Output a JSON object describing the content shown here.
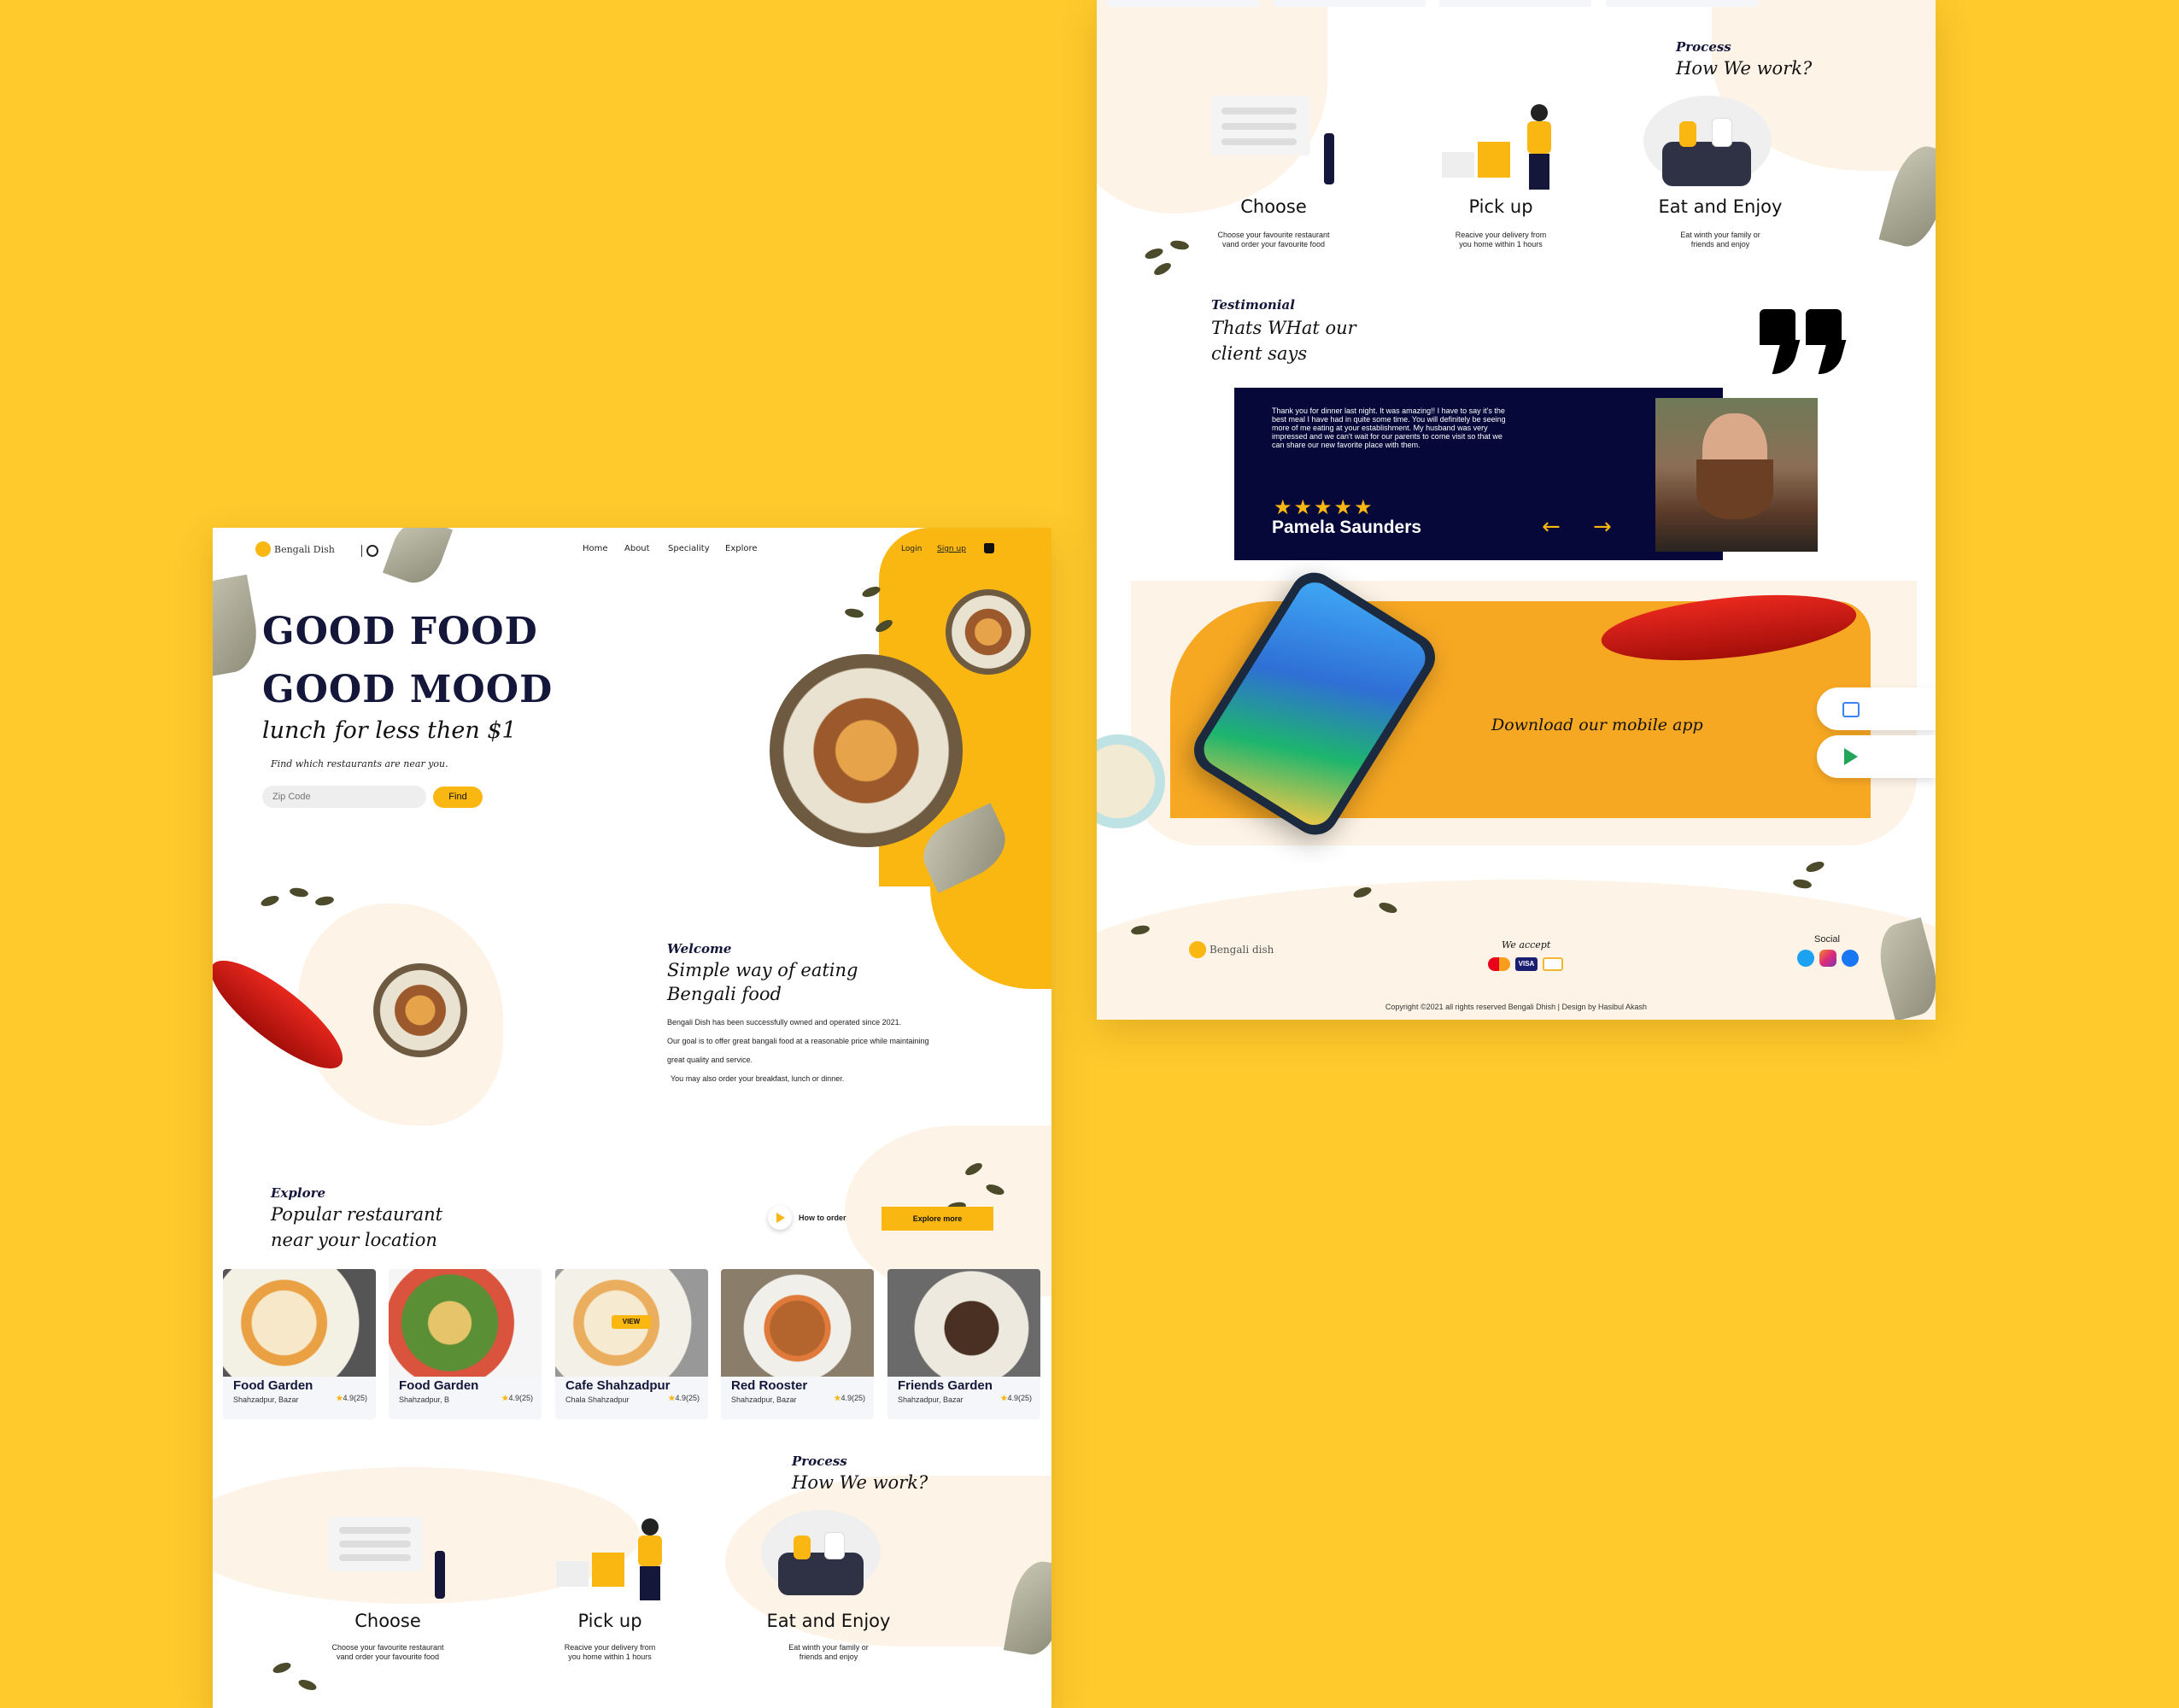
{
  "colors": {
    "background": "#FFCA2C",
    "accent": "#FAB711",
    "navy": "#14163A",
    "dark_card": "#050838",
    "cream": "#FDF3E6"
  },
  "left": {
    "nav": {
      "brand": "Bengali Dish",
      "links": [
        "Home",
        "About",
        "Speciality",
        "Explore"
      ],
      "login": "Login",
      "signup": "Sign up"
    },
    "hero": {
      "line1": "GOOD FOOD",
      "line2": "GOOD MOOD",
      "line3": "lunch for less then $1",
      "subtitle": "Find which restaurants are near you.",
      "zip_placeholder": "Zip Code",
      "find_label": "Find"
    },
    "welcome": {
      "eyebrow": "Welcome",
      "title_line1": "Simple way of eating",
      "title_line2": "Bengali food",
      "p1": "Bengali Dish has been successfully owned and operated since 2021.",
      "p2": "Our goal is to offer great bangali food at a reasonable price while maintaining",
      "p3": "great quality and service.",
      "p4": "You may also order your breakfast, lunch or dinner."
    },
    "explore": {
      "eyebrow": "Explore",
      "title_line1": "Popular restaurant",
      "title_line2": "near your location",
      "how_to_order": "How to order",
      "explore_more": "Explore more",
      "view_label": "VIEW",
      "cards": [
        {
          "name": "Food Garden",
          "location": "Shahzadpur, Bazar",
          "rating": "4.9(25)"
        },
        {
          "name": "Food Garden",
          "location": "Shahzadpur, B",
          "rating": "4.9(25)"
        },
        {
          "name": "Cafe Shahzadpur",
          "location": "Chala Shahzadpur",
          "rating": "4.9(25)"
        },
        {
          "name": "Red Rooster",
          "location": "Shahzadpur, Bazar",
          "rating": "4.9(25)"
        },
        {
          "name": "Friends Garden",
          "location": "Shahzadpur, Bazar",
          "rating": "4.9(25)"
        }
      ]
    },
    "process": {
      "eyebrow": "Process",
      "title": "How We work?",
      "steps": [
        {
          "title": "Choose",
          "desc1": "Choose your favourite restaurant",
          "desc2": "vand order your favourite food"
        },
        {
          "title": "Pick up",
          "desc1": "Reacive your delivery from",
          "desc2": "you home within 1 hours"
        },
        {
          "title": "Eat and Enjoy",
          "desc1": "Eat winth your family or",
          "desc2": "friends and enjoy"
        }
      ]
    }
  },
  "right": {
    "process": {
      "eyebrow": "Process",
      "title": "How We work?",
      "steps": [
        {
          "title": "Choose",
          "desc1": "Choose your favourite restaurant",
          "desc2": "vand order your favourite food"
        },
        {
          "title": "Pick up",
          "desc1": "Reacive your delivery from",
          "desc2": "you home within 1 hours"
        },
        {
          "title": "Eat and Enjoy",
          "desc1": "Eat winth your family or",
          "desc2": "friends and enjoy"
        }
      ]
    },
    "testimonial": {
      "eyebrow": "Testimonial",
      "title_line1": "Thats WHat our",
      "title_line2": "client says",
      "quote": "Thank you for dinner last night. It was amazing!! I have to say it's the best meal I have had in quite some time. You will definitely be seeing more of me eating at your establishment. My husband was very impressed and we can't wait for our parents to come visit so that we can share our new favorite place with them.",
      "stars": "★★★★★",
      "rating": 5,
      "name": "Pamela Saunders"
    },
    "app": {
      "cta": "Download our mobile app"
    },
    "footer": {
      "brand": "Bengali dish",
      "we_accept": "We accept",
      "visa": "VISA",
      "social": "Social",
      "copyright": "Copyright ©2021 all rights reserved Bengali Dhish | Design by Hasibul Akash"
    }
  }
}
